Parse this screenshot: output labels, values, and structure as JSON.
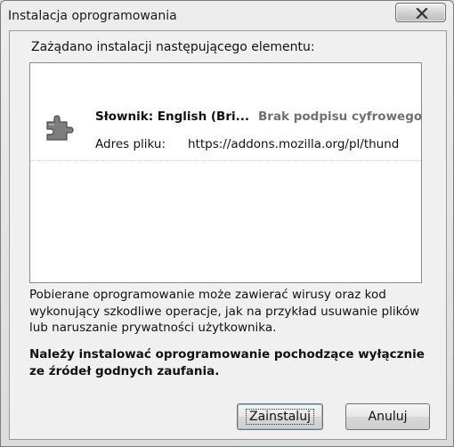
{
  "window": {
    "title": "Instalacja oprogramowania",
    "close_icon": "close-x-icon"
  },
  "prompt": "Zażądano instalacji następującego elementu:",
  "item": {
    "icon": "puzzle-piece-icon",
    "name": "Słownik: English (Bri...",
    "signature_status": "Brak podpisu cyfrowego",
    "address_label": "Adres pliku:",
    "address_url": "https://addons.mozilla.org/pl/thund"
  },
  "warning": {
    "text": "Pobierane oprogramowanie może zawierać wirusy oraz kod wykonujący szkodliwe operacje, jak na przykład usuwanie plików lub naruszanie prywatności użytkownika.",
    "bold_text": "Należy instalować oprogramowanie pochodzące wyłącznie ze źródeł godnych zaufania."
  },
  "buttons": {
    "install": "Zainstaluj",
    "cancel": "Anuluj"
  }
}
